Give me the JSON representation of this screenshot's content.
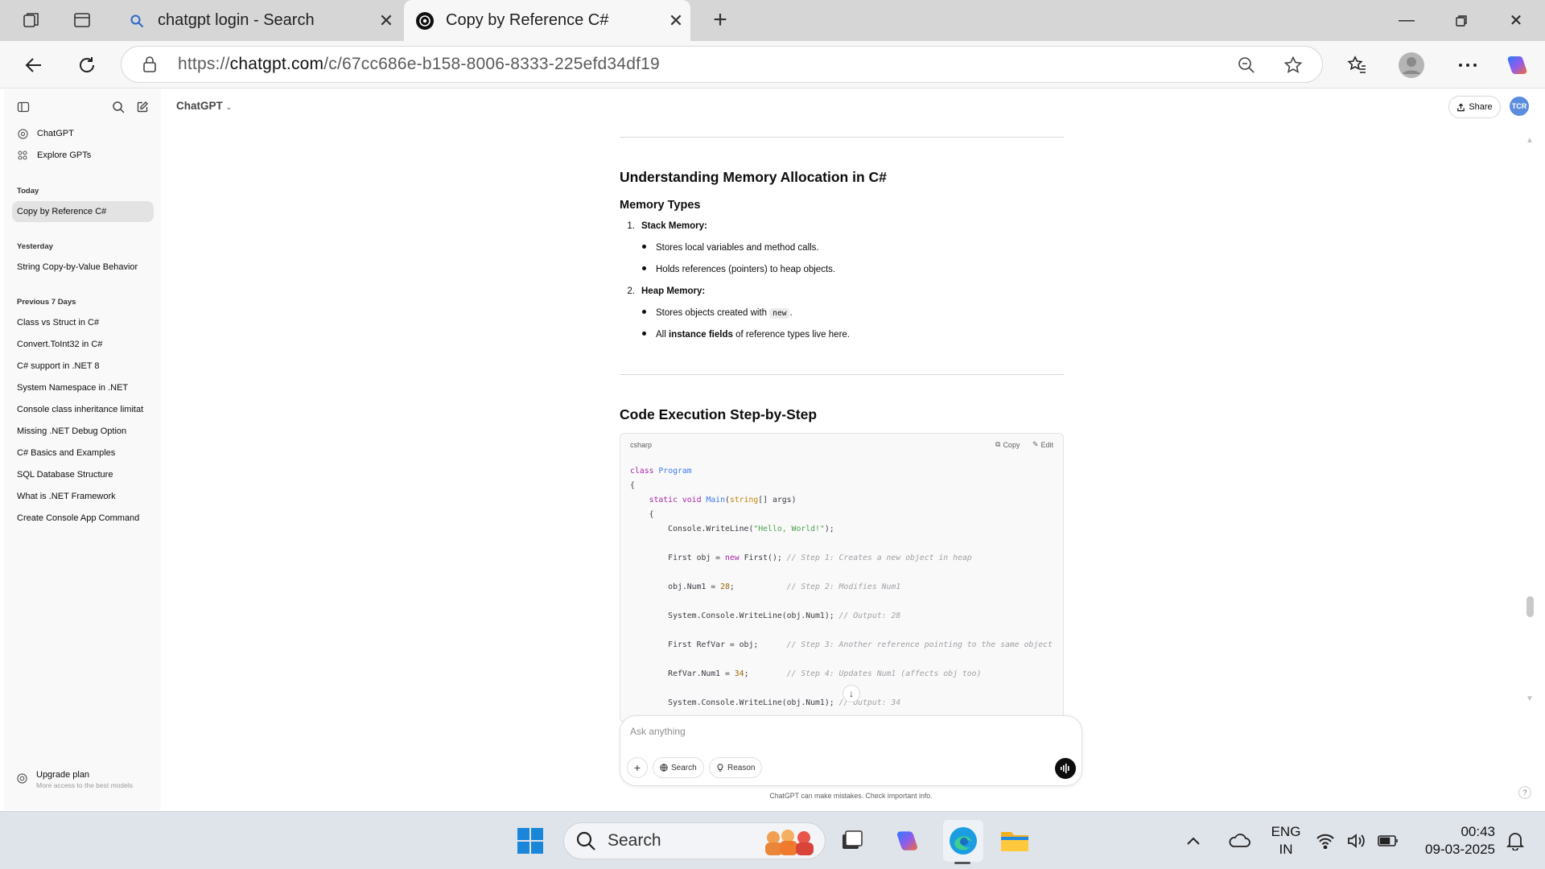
{
  "browser": {
    "tabs": [
      {
        "title": "chatgpt login - Search",
        "active": false
      },
      {
        "title": "Copy by Reference C#",
        "active": true
      }
    ],
    "url_prefix": "https://",
    "url_host": "chatgpt.com",
    "url_path": "/c/67cc686e-b158-8006-8333-225efd34df19"
  },
  "sidebar": {
    "top_items": [
      {
        "label": "ChatGPT",
        "icon": "openai-logo-icon"
      },
      {
        "label": "Explore GPTs",
        "icon": "grid-icon"
      }
    ],
    "sections": [
      {
        "title": "Today",
        "items": [
          "Copy by Reference C#"
        ]
      },
      {
        "title": "Yesterday",
        "items": [
          "String Copy-by-Value Behavior"
        ]
      },
      {
        "title": "Previous 7 Days",
        "items": [
          "Class vs Struct in C#",
          "Convert.ToInt32 in C#",
          "C# support in .NET 8",
          "System Namespace in .NET",
          "Console class inheritance limitat",
          "Missing .NET Debug Option",
          "C# Basics and Examples",
          "SQL Database Structure",
          "What is .NET Framework",
          "Create Console App Command"
        ]
      }
    ],
    "upgrade": {
      "title": "Upgrade plan",
      "subtitle": "More access to the best models"
    }
  },
  "header": {
    "model": "ChatGPT",
    "share_label": "Share",
    "avatar_initials": "TCR"
  },
  "message": {
    "heading1": "Understanding Memory Allocation in C#",
    "subheading": "Memory Types",
    "list": [
      {
        "num": "1.",
        "label": "Stack Memory:",
        "bullets": [
          "Stores local variables and method calls.",
          "Holds references (pointers) to heap objects."
        ]
      },
      {
        "num": "2.",
        "label": "Heap Memory:",
        "bullets": [
          "Stores objects created with",
          "of reference types live here."
        ]
      }
    ],
    "inline_code_new": "new",
    "heap_bullet2_pre": "All",
    "heap_bullet2_bold": "instance fields",
    "heading2": "Code Execution Step-by-Step",
    "code": {
      "language": "csharp",
      "copy_label": "Copy",
      "edit_label": "Edit"
    }
  },
  "composer": {
    "placeholder": "Ask anything",
    "search_label": "Search",
    "reason_label": "Reason",
    "disclaimer": "ChatGPT can make mistakes. Check important info."
  },
  "taskbar": {
    "search_label": "Search",
    "lang_line1": "ENG",
    "lang_line2": "IN",
    "time": "00:43",
    "date": "09-03-2025"
  },
  "colors": {
    "accent": "#0d0d0d",
    "avatar_bg": "#5b8dde",
    "sidebar_bg": "#f9f9f9"
  }
}
